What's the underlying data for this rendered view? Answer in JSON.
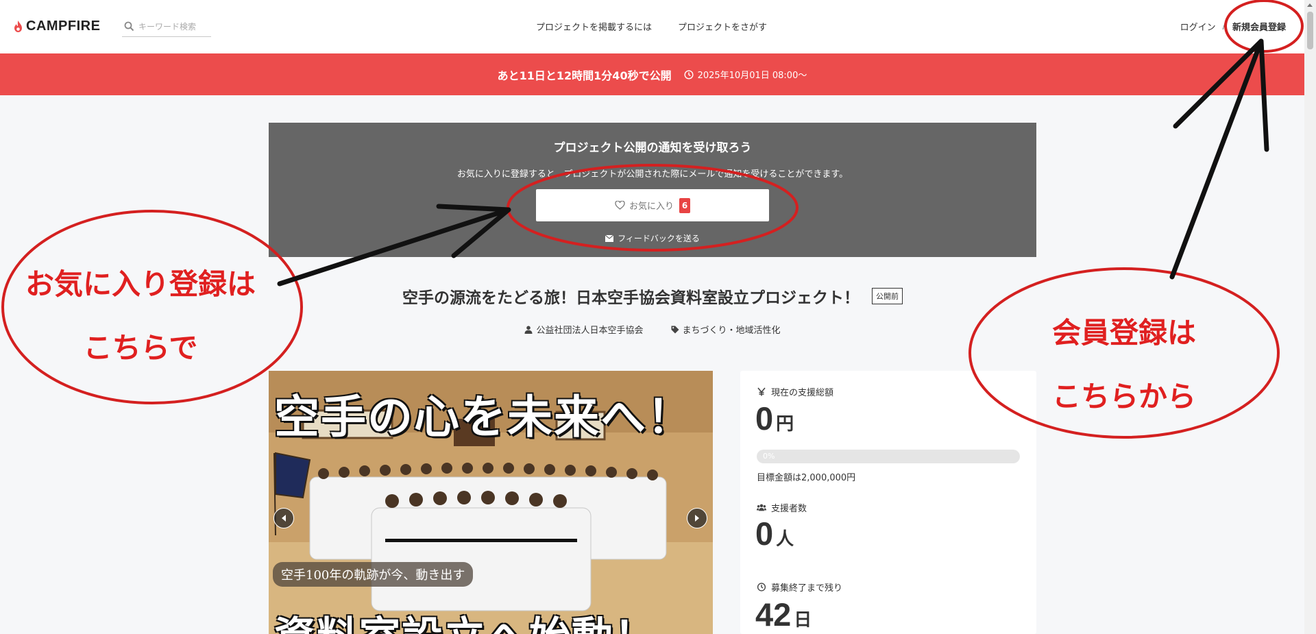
{
  "header": {
    "logo_text": "CAMPFIRE",
    "search_placeholder": "キーワード検索",
    "nav": [
      "プロジェクトを掲載するには",
      "プロジェクトをさがす"
    ],
    "login": "ログイン",
    "separator": "/",
    "signup": "新規会員登録"
  },
  "banner": {
    "countdown": "あと11日と12時間1分40秒で公開",
    "date": "2025年10月01日 08:00〜"
  },
  "notify": {
    "title": "プロジェクト公開の通知を受け取ろう",
    "description": "お気に入りに登録すると、プロジェクトが公開された際にメールで通知を受けることができます。",
    "favorite_label": "お気に入り",
    "favorite_count": "6",
    "feedback": "フィードバックを送る"
  },
  "project": {
    "title": "空手の源流をたどる旅！日本空手協会資料室設立プロジェクト！",
    "status_badge": "公開前",
    "owner": "公益社団法人日本空手協会",
    "category": "まちづくり・地域活性化"
  },
  "carousel": {
    "headline": "空手の心を未来へ！",
    "caption": "空手100年の軌跡が今、動き出す",
    "bottom_text": "資料室設立へ始動！"
  },
  "stats": {
    "total_label": "現在の支援総額",
    "total_value": "0",
    "total_unit": "円",
    "progress_percent": 0,
    "progress_text": "0%",
    "goal": "目標金額は2,000,000円",
    "backers_label": "支援者数",
    "backers_value": "0",
    "backers_unit": "人",
    "remaining_label": "募集終了まで残り",
    "remaining_value": "42",
    "remaining_unit": "日"
  },
  "annotations": {
    "favorite_note_line1": "お気に入り登録は",
    "favorite_note_line2": "こちらで",
    "member_note_line1": "会員登録は",
    "member_note_line2": "こちらから",
    "color": "#e02020"
  },
  "colors": {
    "brand_red": "#ec4c4c",
    "badge_red": "#e84343",
    "notify_bg": "#666666"
  }
}
